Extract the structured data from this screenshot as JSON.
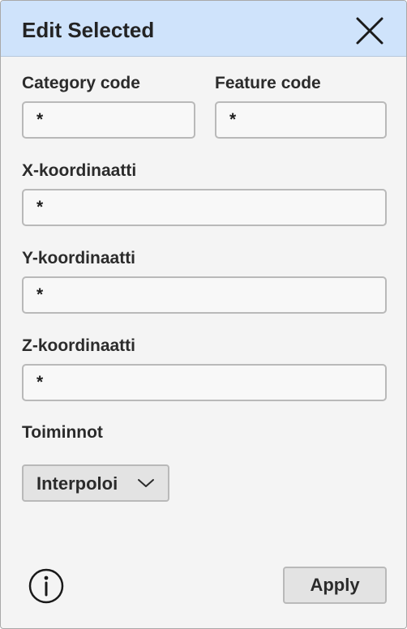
{
  "dialog": {
    "title": "Edit Selected",
    "close_icon": "close-x-icon"
  },
  "fields": {
    "category_code": {
      "label": "Category code",
      "value": "*"
    },
    "feature_code": {
      "label": "Feature code",
      "value": "*"
    },
    "x_coordinate": {
      "label": "X-koordinaatti",
      "value": "*"
    },
    "y_coordinate": {
      "label": "Y-koordinaatti",
      "value": "*"
    },
    "z_coordinate": {
      "label": "Z-koordinaatti",
      "value": "*"
    }
  },
  "actions": {
    "label": "Toiminnot",
    "dropdown_value": "Interpoloi",
    "dropdown_icon": "chevron-down-icon"
  },
  "footer": {
    "info_icon": "info-icon",
    "apply_label": "Apply"
  },
  "colors": {
    "titlebar_bg": "#cfe3fb",
    "panel_bg": "#f4f4f4",
    "button_bg": "#e3e3e3",
    "field_border": "#b9b9b9",
    "text": "#2b2b2b"
  }
}
